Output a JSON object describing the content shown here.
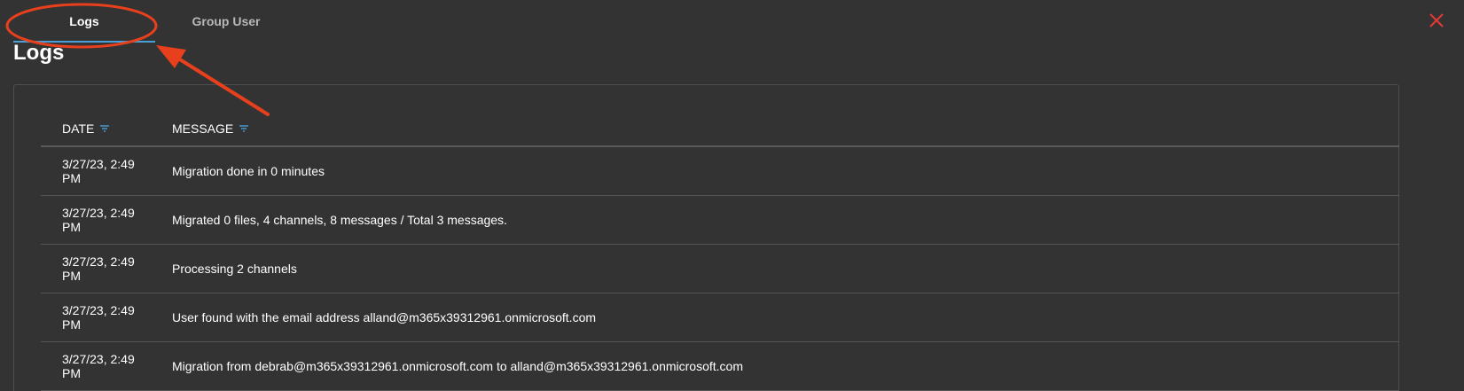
{
  "tabs": [
    {
      "label": "Logs",
      "active": true
    },
    {
      "label": "Group User",
      "active": false
    }
  ],
  "page_title": "Logs",
  "close_icon": "close-icon",
  "table": {
    "columns": [
      "DATE",
      "MESSAGE"
    ],
    "rows": [
      {
        "date": "3/27/23, 2:49 PM",
        "message": "Migration done in 0 minutes"
      },
      {
        "date": "3/27/23, 2:49 PM",
        "message": "Migrated 0 files, 4 channels, 8 messages / Total 3 messages."
      },
      {
        "date": "3/27/23, 2:49 PM",
        "message": "Processing 2 channels"
      },
      {
        "date": "3/27/23, 2:49 PM",
        "message": "User found with the email address alland@m365x39312961.onmicrosoft.com"
      },
      {
        "date": "3/27/23, 2:49 PM",
        "message": "Migration from debrab@m365x39312961.onmicrosoft.com to alland@m365x39312961.onmicrosoft.com"
      }
    ]
  },
  "colors": {
    "background": "#333333",
    "accent": "#4a9fd8",
    "close": "#e53935",
    "annotation": "#e8401c"
  }
}
